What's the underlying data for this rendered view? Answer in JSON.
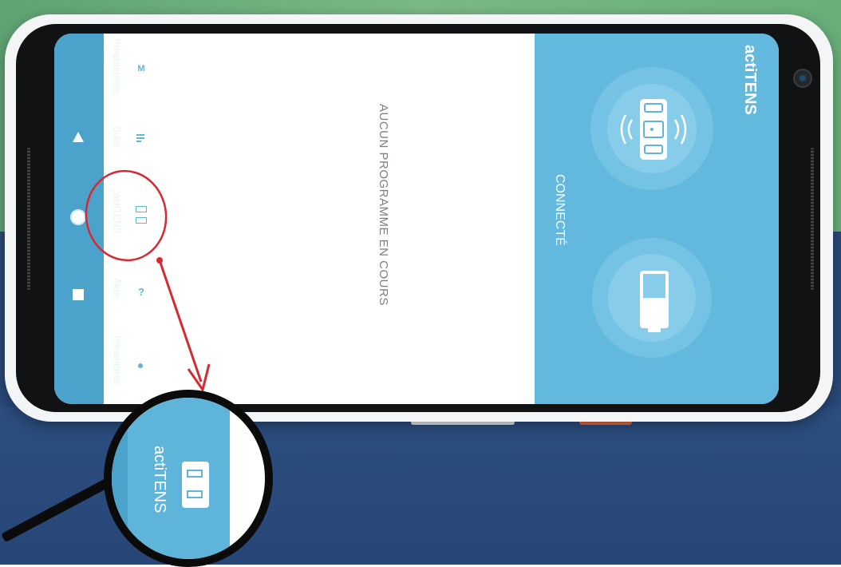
{
  "app": {
    "name": "actiTENS"
  },
  "status": {
    "connection": "CONNECTÉ"
  },
  "main": {
    "message": "AUCUN PROGRAMME EN COURS"
  },
  "nav": {
    "items": [
      {
        "label": "Programmes",
        "icon": "programs-icon"
      },
      {
        "label": "Suivi",
        "icon": "tracking-icon"
      },
      {
        "label": "actiTENS",
        "icon": "device-icon"
      },
      {
        "label": "Aide",
        "icon": "help-icon"
      },
      {
        "label": "Paramètres",
        "icon": "settings-icon"
      }
    ]
  },
  "system_nav": [
    "back-icon",
    "home-icon",
    "recents-icon"
  ],
  "zoom": {
    "label": "actiTENS"
  },
  "colors": {
    "accent": "#63b8de",
    "sidebar": "#5fb4d9",
    "annotation": "#d62a32"
  }
}
